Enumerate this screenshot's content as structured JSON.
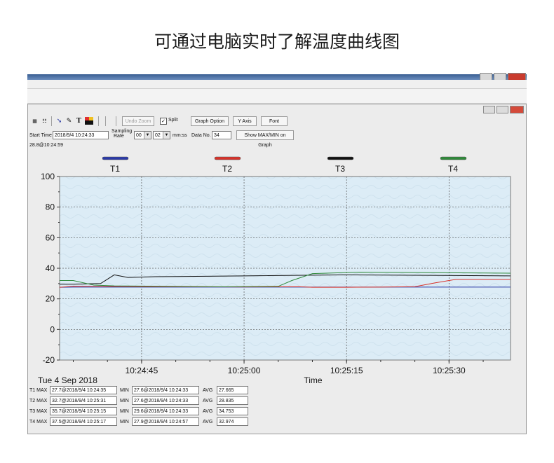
{
  "banner": {
    "caption": "可通过电脑实时了解温度曲线图"
  },
  "toolbar": {
    "undo_zoom": "Undo Zoom",
    "split_label": "Split",
    "split_checked": "✓",
    "graph_option": "Graph Option",
    "y_axis": "Y Axis",
    "font": "Font",
    "text_tool": "T"
  },
  "params": {
    "start_time_label": "Start Time",
    "start_time_value": "2018/9/4 10:24:33",
    "sampling_rate_label_1": "Sampling",
    "sampling_rate_label_2": "Rate",
    "rate_min": "00",
    "rate_sec": "02",
    "rate_unit": "mm:ss",
    "data_no_label": "Data No.",
    "data_no_value": "34",
    "show_maxmin": "Show MAX/MIN on Graph"
  },
  "cursor_readout": "28.8@10:24:59",
  "date_label": "Tue 4 Sep 2018",
  "colors": {
    "T1": "#2b3aa8",
    "T2": "#d8322a",
    "T3": "#111111",
    "T4": "#2f8a3a",
    "plot_bg": "#dcecf6",
    "grid": "#555555"
  },
  "chart_data": {
    "type": "line",
    "xlabel": "Time",
    "ylabel": "",
    "ylim": [
      -20,
      100
    ],
    "yticks": [
      -20,
      0,
      20,
      40,
      60,
      80,
      100
    ],
    "ytick_labels": [
      "-20",
      "0",
      "20",
      "40",
      "60",
      "80",
      "100"
    ],
    "xlim": [
      "10:24:33",
      "10:25:39"
    ],
    "xticks": [
      "10:24:45",
      "10:25:00",
      "10:25:15",
      "10:25:30"
    ],
    "grid": true,
    "legend": "top",
    "series": [
      {
        "name": "T1",
        "color": "#2b3aa8",
        "x": [
          "10:24:33",
          "10:24:35",
          "10:25:39"
        ],
        "y": [
          27.6,
          27.7,
          27.7
        ]
      },
      {
        "name": "T2",
        "color": "#d8322a",
        "x": [
          "10:24:33",
          "10:24:35",
          "10:24:45",
          "10:25:00",
          "10:25:08",
          "10:25:10",
          "10:25:15",
          "10:25:20",
          "10:25:25",
          "10:25:28",
          "10:25:31",
          "10:25:39"
        ],
        "y": [
          27.6,
          28.2,
          28.0,
          27.8,
          27.9,
          27.6,
          27.6,
          27.7,
          28.0,
          30.5,
          32.7,
          32.7
        ]
      },
      {
        "name": "T3",
        "color": "#111111",
        "x": [
          "10:24:33",
          "10:24:35",
          "10:24:39",
          "10:24:41",
          "10:24:43",
          "10:24:47",
          "10:25:00",
          "10:25:15",
          "10:25:39"
        ],
        "y": [
          29.6,
          29.6,
          30.0,
          35.7,
          34.0,
          34.5,
          35.0,
          35.7,
          35.0
        ]
      },
      {
        "name": "T4",
        "color": "#2f8a3a",
        "x": [
          "10:24:33",
          "10:24:35",
          "10:24:38",
          "10:24:41",
          "10:24:57",
          "10:25:05",
          "10:25:07",
          "10:25:10",
          "10:25:17",
          "10:25:39"
        ],
        "y": [
          32.0,
          32.0,
          29.0,
          28.5,
          27.9,
          28.2,
          32.0,
          36.5,
          37.5,
          36.8
        ]
      }
    ]
  },
  "stats": [
    {
      "name": "T1 MAX",
      "max": "27.7@2018/9/4 10:24:35",
      "min_label": "MIN",
      "min": "27.6@2018/9/4 10:24:33",
      "avg_label": "AVG",
      "avg": "27.665"
    },
    {
      "name": "T2 MAX",
      "max": "32.7@2018/9/4 10:25:31",
      "min_label": "MIN",
      "min": "27.6@2018/9/4 10:24:33",
      "avg_label": "AVG",
      "avg": "28.835"
    },
    {
      "name": "T3 MAX",
      "max": "35.7@2018/9/4 10:25:15",
      "min_label": "MIN",
      "min": "29.6@2018/9/4 10:24:33",
      "avg_label": "AVG",
      "avg": "34.753"
    },
    {
      "name": "T4 MAX",
      "max": "37.5@2018/9/4 10:25:17",
      "min_label": "MIN",
      "min": "27.9@2018/9/4 10:24:57",
      "avg_label": "AVG",
      "avg": "32.974"
    }
  ]
}
